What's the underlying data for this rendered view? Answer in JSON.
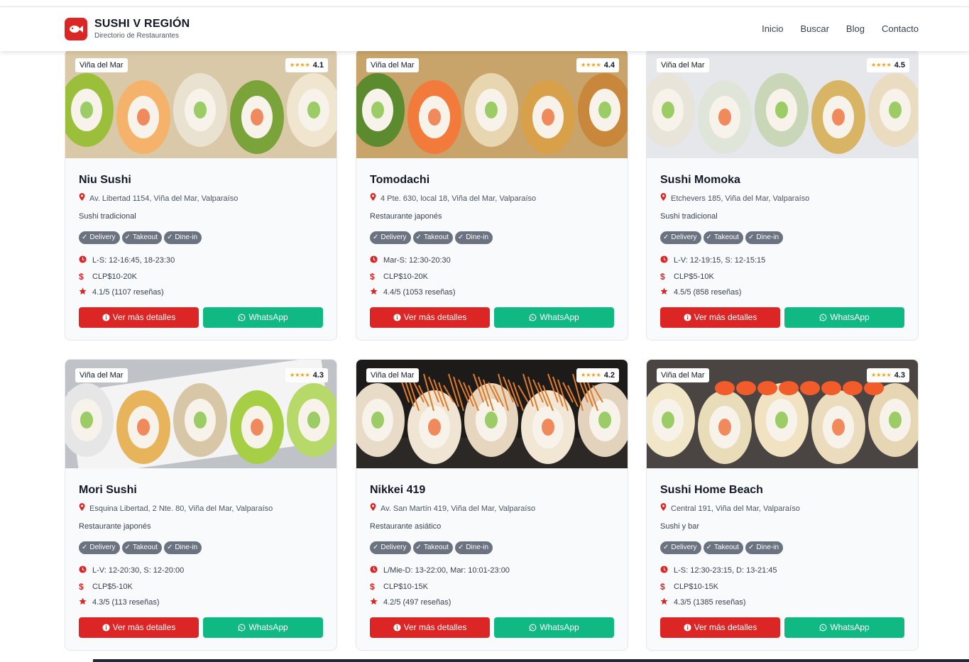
{
  "header": {
    "brand_title": "SUSHI V REGIÓN",
    "brand_subtitle": "Directorio de Restaurantes",
    "nav": [
      "Inicio",
      "Buscar",
      "Blog",
      "Contacto"
    ]
  },
  "colors": {
    "accent": "#dc2626",
    "whatsapp": "#10b981",
    "tag_bg": "#6b7280",
    "star": "#f59e0b"
  },
  "labels": {
    "details_button": "Ver más detalles",
    "whatsapp_button": "WhatsApp",
    "stars_glyph": "★★★★"
  },
  "restaurants": [
    {
      "location": "Viña del Mar",
      "rating": "4.1",
      "name": "Niu Sushi",
      "address": "Av. Libertad 1154, Viña del Mar, Valparaíso",
      "category": "Sushi tradicional",
      "tags": [
        "Delivery",
        "Takeout",
        "Dine-in"
      ],
      "hours": "L-S: 12-16:45, 18-23:30",
      "price": "CLP$10-20K",
      "reviews": "4.1/5 (1107 reseñas)"
    },
    {
      "location": "Viña del Mar",
      "rating": "4.4",
      "name": "Tomodachi",
      "address": "4 Pte. 630, local 18, Viña del Mar, Valparaíso",
      "category": "Restaurante japonés",
      "tags": [
        "Delivery",
        "Takeout",
        "Dine-in"
      ],
      "hours": "Mar-S: 12:30-20:30",
      "price": "CLP$10-20K",
      "reviews": "4.4/5 (1053 reseñas)"
    },
    {
      "location": "Viña del Mar",
      "rating": "4.5",
      "name": "Sushi Momoka",
      "address": "Etchevers 185, Viña del Mar, Valparaíso",
      "category": "Sushi tradicional",
      "tags": [
        "Delivery",
        "Takeout",
        "Dine-in"
      ],
      "hours": "L-V: 12-19:15, S: 12-15:15",
      "price": "CLP$5-10K",
      "reviews": "4.5/5 (858 reseñas)"
    },
    {
      "location": "Viña del Mar",
      "rating": "4.3",
      "name": "Mori Sushi",
      "address": "Esquina Libertad, 2 Nte. 80, Viña del Mar, Valparaíso",
      "category": "Restaurante japonés",
      "tags": [
        "Delivery",
        "Takeout",
        "Dine-in"
      ],
      "hours": "L-V: 12-20:30, S: 12-20:00",
      "price": "CLP$5-10K",
      "reviews": "4.3/5 (113 reseñas)"
    },
    {
      "location": "Viña del Mar",
      "rating": "4.2",
      "name": "Nikkei 419",
      "address": "Av. San Martín 419, Viña del Mar, Valparaíso",
      "category": "Restaurante asiático",
      "tags": [
        "Delivery",
        "Takeout",
        "Dine-in"
      ],
      "hours": "L/Mie-D: 13-22:00, Mar: 10:01-23:00",
      "price": "CLP$10-15K",
      "reviews": "4.2/5 (497 reseñas)"
    },
    {
      "location": "Viña del Mar",
      "rating": "4.3",
      "name": "Sushi Home Beach",
      "address": "Central 191, Viña del Mar, Valparaíso",
      "category": "Sushi y bar",
      "tags": [
        "Delivery",
        "Takeout",
        "Dine-in"
      ],
      "hours": "L-S: 12:30-23:15, D: 13-21:45",
      "price": "CLP$10-15K",
      "reviews": "4.3/5 (1385 reseñas)"
    }
  ]
}
